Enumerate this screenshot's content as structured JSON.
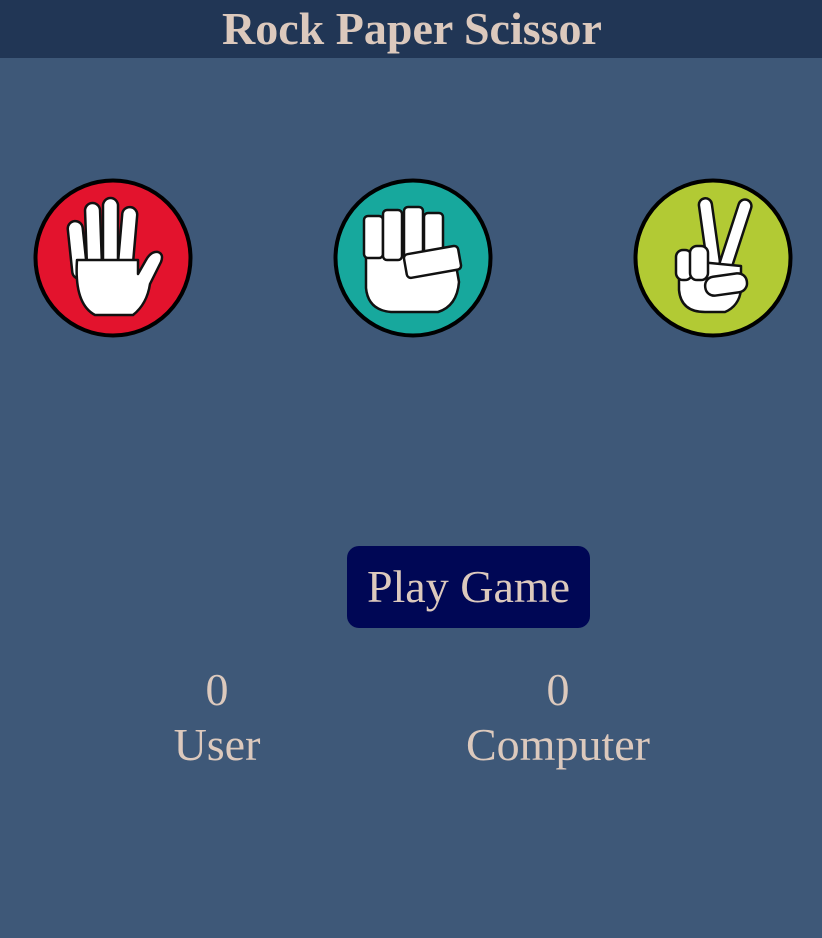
{
  "header": {
    "title": "Rock Paper Scissor"
  },
  "choices": [
    {
      "id": "paper",
      "icon": "open-hand-icon",
      "color": "#e3132d"
    },
    {
      "id": "rock",
      "icon": "fist-icon",
      "color": "#17a89d"
    },
    {
      "id": "scissors",
      "icon": "peace-sign-icon",
      "color": "#b2ca34"
    }
  ],
  "controls": {
    "play_label": "Play Game"
  },
  "scoreboard": {
    "user": {
      "score": "0",
      "label": "User"
    },
    "computer": {
      "score": "0",
      "label": "Computer"
    }
  },
  "colors": {
    "background": "#3e5878",
    "header": "#213655",
    "button": "#000755",
    "text": "#dcc9bd"
  }
}
